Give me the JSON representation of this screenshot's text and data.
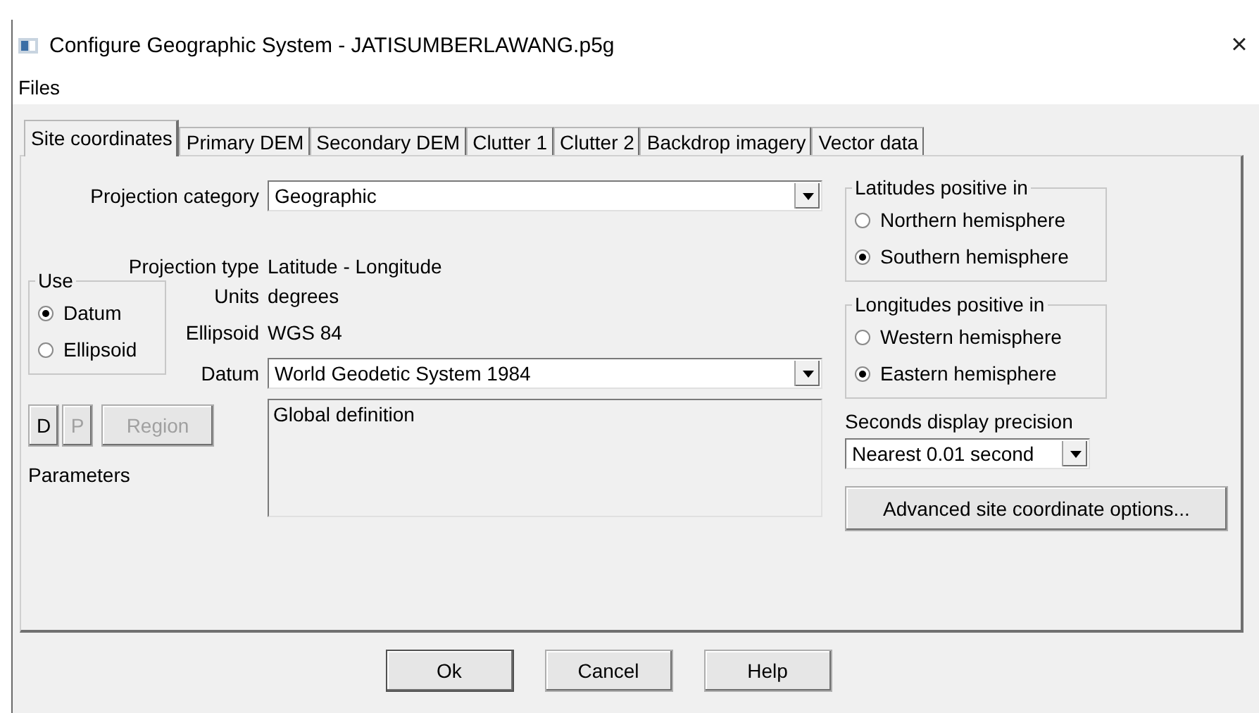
{
  "window": {
    "title": "Configure Geographic System - JATISUMBERLAWANG.p5g",
    "close": "×"
  },
  "menu": [
    "Files"
  ],
  "tabs": [
    {
      "label": "Site coordinates",
      "selected": true
    },
    {
      "label": "Primary DEM",
      "selected": false
    },
    {
      "label": "Secondary DEM",
      "selected": false
    },
    {
      "label": "Clutter 1",
      "selected": false
    },
    {
      "label": "Clutter 2",
      "selected": false
    },
    {
      "label": "Backdrop imagery",
      "selected": false
    },
    {
      "label": "Vector data",
      "selected": false
    }
  ],
  "projection_category": {
    "label": "Projection category",
    "value": "Geographic"
  },
  "projection_type": {
    "label": "Projection type",
    "value": "Latitude - Longitude"
  },
  "use": {
    "title": "Use",
    "options": [
      {
        "label": "Datum",
        "selected": true
      },
      {
        "label": "Ellipsoid",
        "selected": false
      }
    ]
  },
  "units": {
    "label": "Units",
    "value": "degrees"
  },
  "ellipsoid": {
    "label": "Ellipsoid",
    "value": "WGS 84"
  },
  "datum": {
    "label": "Datum",
    "value": "World Geodetic System 1984"
  },
  "parameter_buttons": [
    {
      "label": "D",
      "disabled": false
    },
    {
      "label": "P",
      "disabled": true
    },
    {
      "label": "Region",
      "disabled": true
    }
  ],
  "parameters_label": "Parameters",
  "definition": "Global definition",
  "latitudes": {
    "title": "Latitudes positive in",
    "options": [
      {
        "label": "Northern hemisphere",
        "selected": false
      },
      {
        "label": "Southern hemisphere",
        "selected": true
      }
    ]
  },
  "longitudes": {
    "title": "Longitudes positive in",
    "options": [
      {
        "label": "Western hemisphere",
        "selected": false
      },
      {
        "label": "Eastern hemisphere",
        "selected": true
      }
    ]
  },
  "seconds_precision": {
    "label": "Seconds display precision",
    "value": "Nearest 0.01 second"
  },
  "advanced_button": "Advanced site coordinate options...",
  "buttons": [
    {
      "label": "Ok",
      "default": true
    },
    {
      "label": "Cancel",
      "default": false
    },
    {
      "label": "Help",
      "default": false
    }
  ]
}
